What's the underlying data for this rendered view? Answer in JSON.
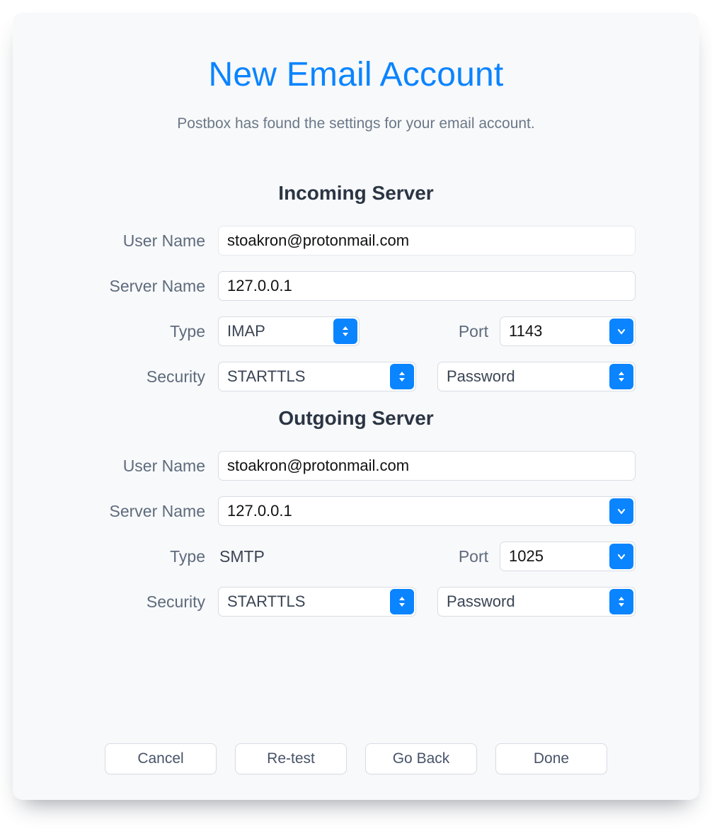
{
  "title": "New Email Account",
  "subtitle": "Postbox has found the settings for your email account.",
  "labels": {
    "user_name": "User Name",
    "server_name": "Server Name",
    "type": "Type",
    "port": "Port",
    "security": "Security"
  },
  "incoming": {
    "heading": "Incoming Server",
    "user_name": "stoakron@protonmail.com",
    "server_name": "127.0.0.1",
    "type": "IMAP",
    "port": "1143",
    "security": "STARTTLS",
    "auth": "Password"
  },
  "outgoing": {
    "heading": "Outgoing Server",
    "user_name": "stoakron@protonmail.com",
    "server_name": "127.0.0.1",
    "type": "SMTP",
    "port": "1025",
    "security": "STARTTLS",
    "auth": "Password"
  },
  "buttons": {
    "cancel": "Cancel",
    "retest": "Re-test",
    "go_back": "Go Back",
    "done": "Done"
  }
}
